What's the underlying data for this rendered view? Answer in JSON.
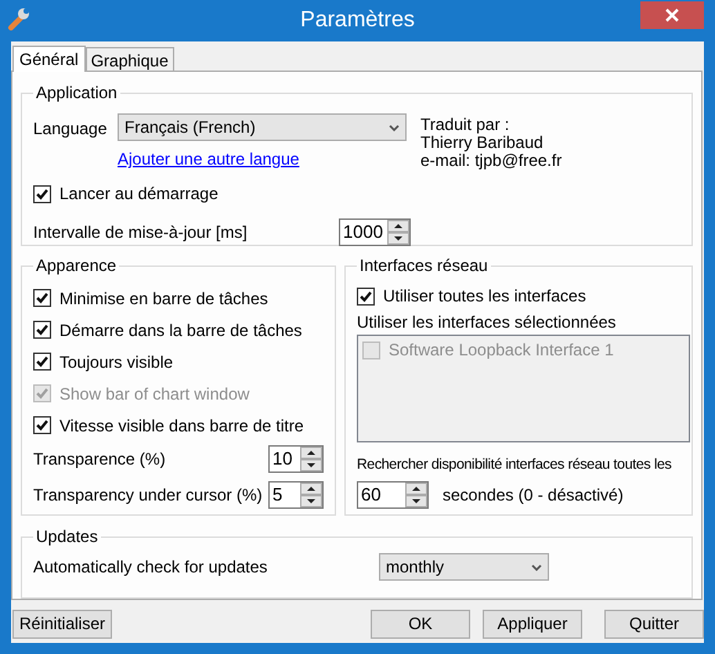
{
  "window": {
    "title": "Paramètres"
  },
  "tabs": [
    {
      "label": "Général",
      "selected": true
    },
    {
      "label": "Graphique",
      "selected": false
    }
  ],
  "application": {
    "legend": "Application",
    "language_label": "Language",
    "language": {
      "value": "Français (French)"
    },
    "add_language_link": "Ajouter une autre langue",
    "translator": [
      "Traduit par :",
      "Thierry Baribaud",
      "e-mail: tjpb@free.fr"
    ],
    "launch_at_startup": {
      "label": "Lancer au démarrage",
      "checked": true
    },
    "update_interval": {
      "label": "Intervalle de mise-à-jour [ms]",
      "value": "1000"
    }
  },
  "appearance": {
    "legend": "Apparence",
    "options": [
      {
        "label": "Minimise en barre de tâches",
        "checked": true,
        "disabled": false
      },
      {
        "label": "Démarre dans la barre de tâches",
        "checked": true,
        "disabled": false
      },
      {
        "label": "Toujours visible",
        "checked": true,
        "disabled": false
      },
      {
        "label": "Show bar of chart window",
        "checked": true,
        "disabled": true
      },
      {
        "label": "Vitesse visible dans barre de titre",
        "checked": true,
        "disabled": false
      }
    ],
    "spinners": [
      {
        "label": "Transparence (%)",
        "value": "10"
      },
      {
        "label": "Transparency under cursor (%)",
        "value": "5"
      }
    ]
  },
  "network": {
    "legend": "Interfaces réseau",
    "use_all": {
      "label": "Utiliser toutes les interfaces",
      "checked": true
    },
    "selected_label": "Utiliser les interfaces sélectionnées",
    "interfaces": [
      {
        "label": "Software Loopback Interface 1",
        "checked": false,
        "disabled": true
      }
    ],
    "poll_label": "Rechercher disponibilité interfaces réseau toutes les",
    "poll_value": "60",
    "poll_unit": "secondes (0 - désactivé)"
  },
  "updates": {
    "legend": "Updates",
    "label": "Automatically check for updates",
    "value": "monthly"
  },
  "reset_button": "Réinitialiser",
  "buttons": [
    "OK",
    "Appliquer",
    "Quitter"
  ]
}
